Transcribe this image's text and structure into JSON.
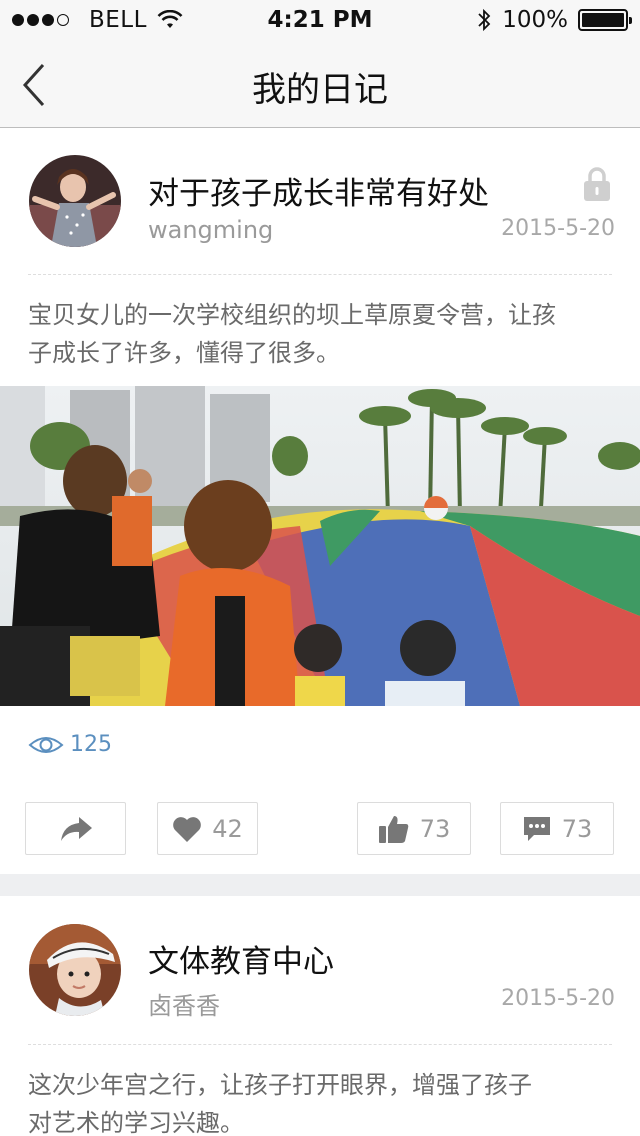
{
  "status_bar": {
    "carrier": "BELL",
    "time": "4:21 PM",
    "battery": "100%",
    "battery_level": 1.0,
    "signal_bars_filled": 3,
    "signal_bars_total": 4
  },
  "nav": {
    "title": "我的日记",
    "back_icon": "chevron-left-icon"
  },
  "posts": [
    {
      "title": "对于孩子成长非常有好处",
      "author": "wangming",
      "date": "2015-5-20",
      "locked": true,
      "excerpt_line1": "宝贝女儿的一次学校组织的坝上草原夏令营，让孩",
      "excerpt_line2": "子成长了许多，懂得了很多。",
      "views": "125",
      "likes": "42",
      "thumbs": "73",
      "comments": "73"
    },
    {
      "title": "文体教育中心",
      "author": "卤香香",
      "date": "2015-5-20",
      "excerpt_line1": "这次少年宫之行，让孩子打开眼界，增强了孩子",
      "excerpt_line2": "对艺术的学习兴趣。"
    }
  ],
  "colors": {
    "accent": "#5b8fbf",
    "nav_bg": "#f7f7f7",
    "page_bg": "#eeeff1"
  }
}
